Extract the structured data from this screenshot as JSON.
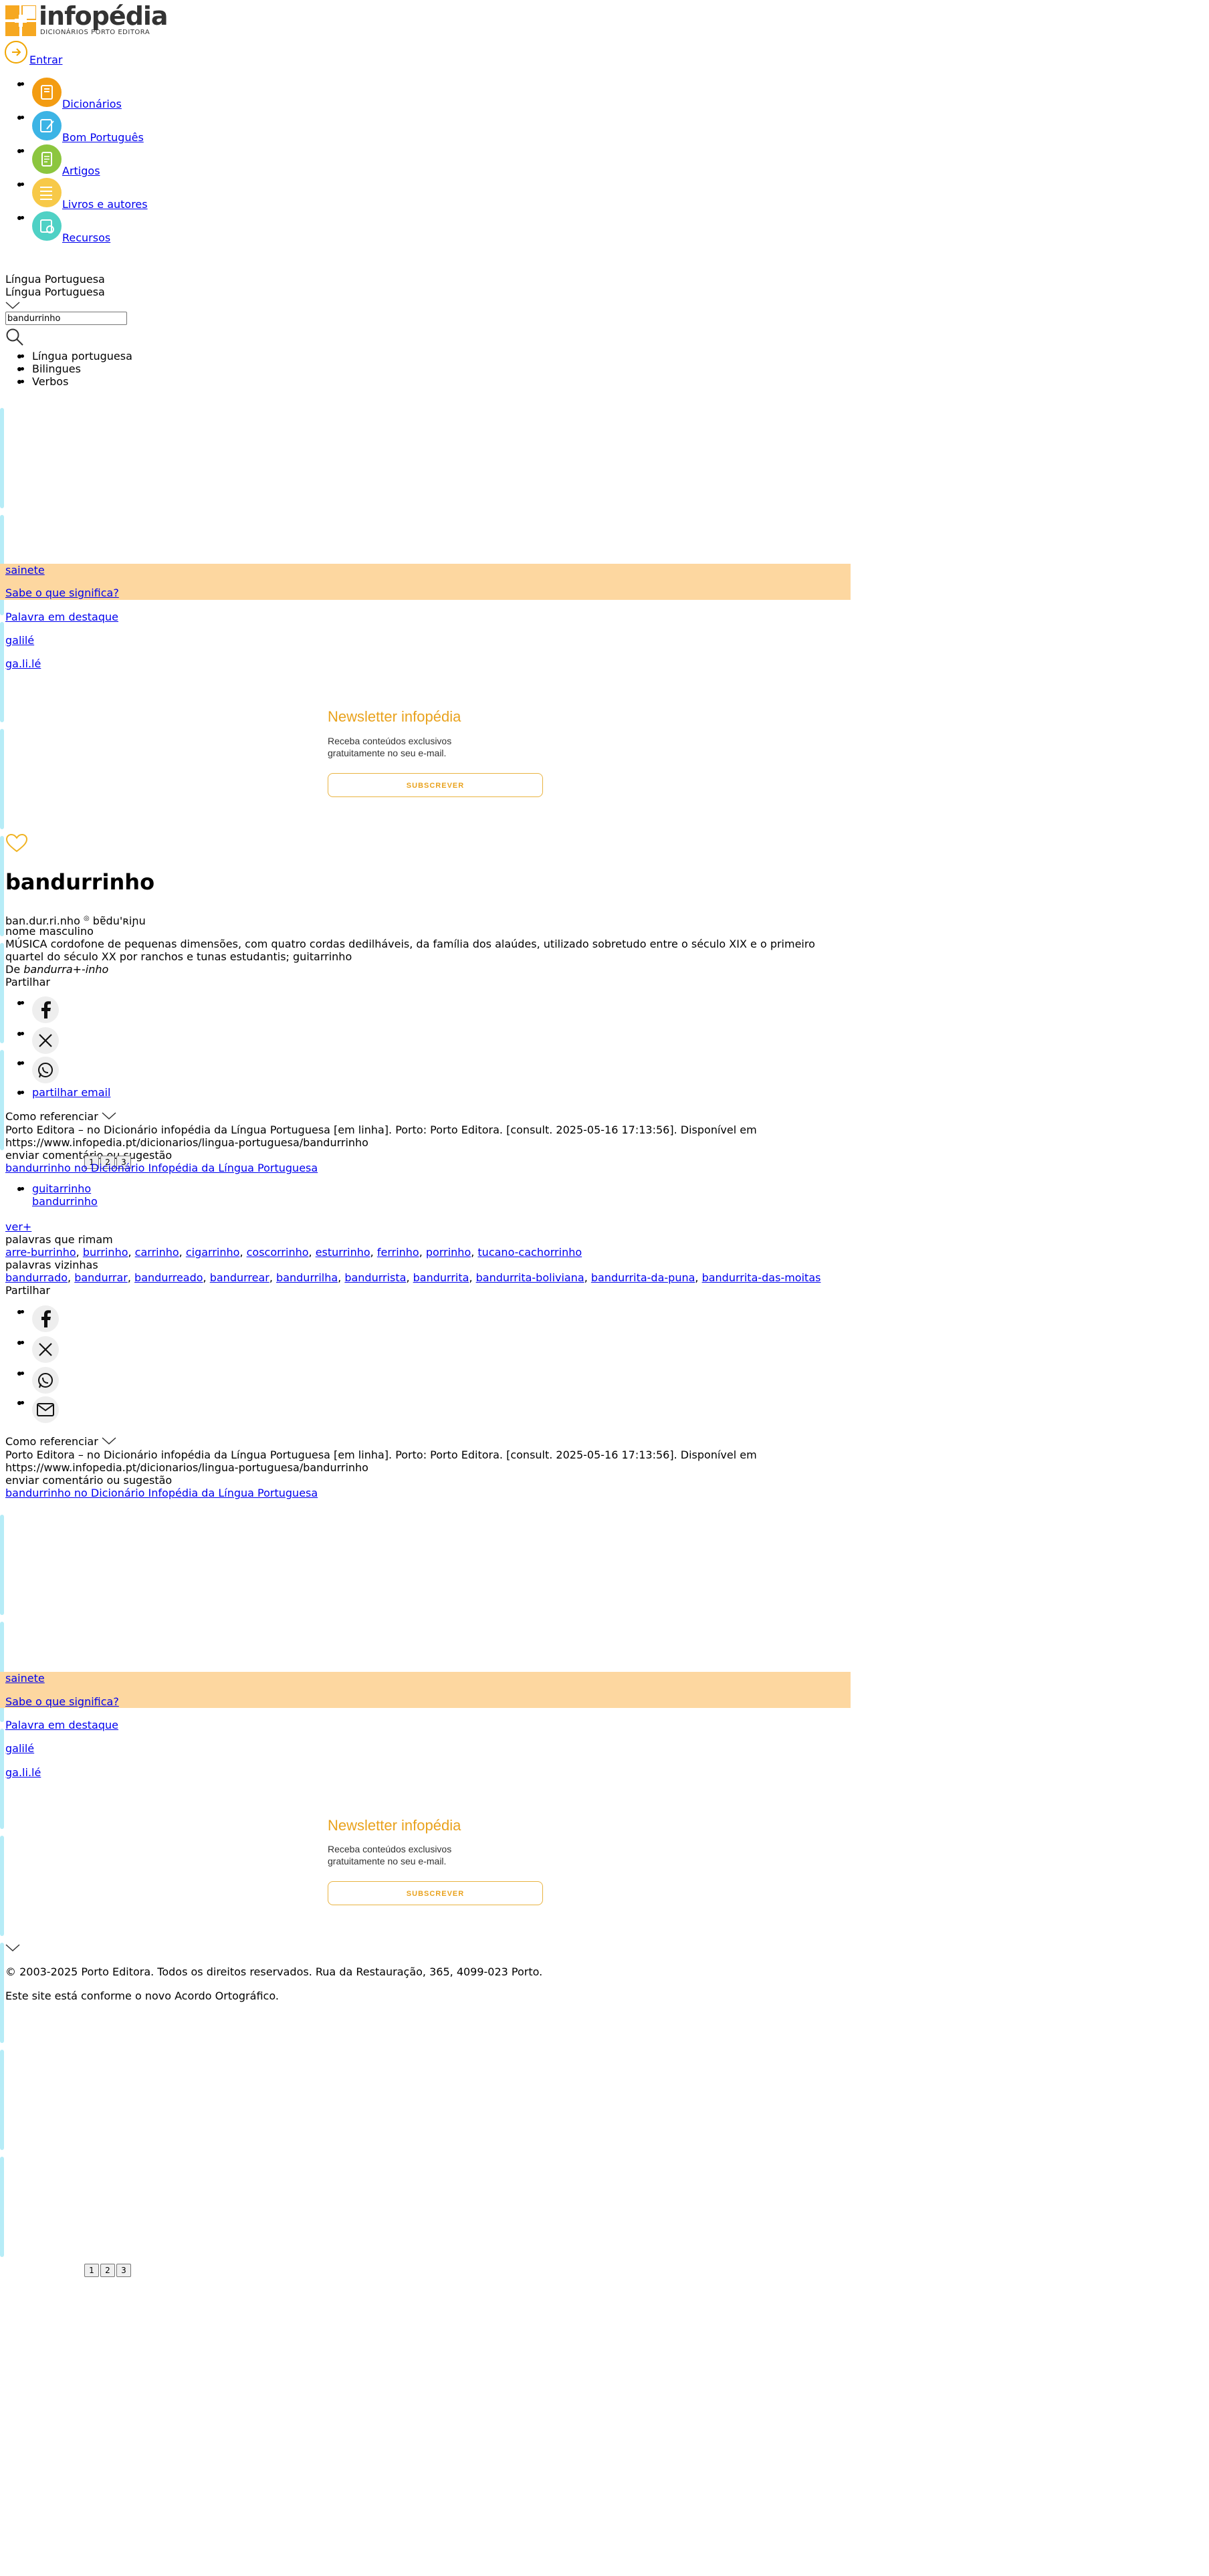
{
  "header": {
    "logo_text": "infopédia",
    "logo_sub": "DICIONÁRIOS PORTO EDITORA",
    "login_label": "Entrar",
    "brand_color": "#f39c12"
  },
  "nav": {
    "items": [
      {
        "label": "Dicionários",
        "icon": "book-icon",
        "color": "#f39c12"
      },
      {
        "label": "Bom Português",
        "icon": "pencil-icon",
        "color": "#3cb4e5"
      },
      {
        "label": "Artigos",
        "icon": "document-icon",
        "color": "#8cc63f"
      },
      {
        "label": "Livros e autores",
        "icon": "books-icon",
        "color": "#f7c948"
      },
      {
        "label": "Recursos",
        "icon": "resources-icon",
        "color": "#4fd1c5"
      }
    ]
  },
  "search": {
    "dictionary_label": "Língua Portuguesa",
    "dictionary_selected": "Língua Portuguesa",
    "query": "bandurrinho",
    "categories": [
      "Língua portuguesa",
      "Bilingues",
      "Verbos"
    ]
  },
  "promo": {
    "featured_word": "sainete",
    "know_meaning": "Sabe o que significa?",
    "highlight_label": "Palavra em destaque",
    "highlight_word": "galilé",
    "highlight_syllables": "ga.li.lé"
  },
  "newsletter": {
    "title": "Newsletter infopédia",
    "text_line1": "Receba conteúdos exclusivos",
    "text_line2": "gratuitamente no seu e-mail.",
    "button": "SUBSCREVER"
  },
  "entry": {
    "word": "bandurrinho",
    "syllables": "ban.dur.ri.nho",
    "pron_marker": "◎",
    "pronunciation": "bɐ̃du'ʀiɲu",
    "grammar": "nome masculino",
    "definition_line1": "MÚSICA cordofone de pequenas dimensões, com quatro cordas dedilháveis, da família dos alaúdes, utilizado sobretudo entre o século XIX e o primeiro",
    "definition_line2": "quartel do século XX por ranchos e tunas estudantis; guitarrinho",
    "etym_prefix": "De",
    "etym_word": "bandurra+-inho",
    "share_label": "Partilhar",
    "share_email_alt": "partilhar email",
    "cite_label": "Como referenciar",
    "cite_line1": "Porto Editora – no Dicionário infopédia da Língua Portuguesa [em linha]. Porto: Porto Editora. [consult. 2025-05-16 17:13:56]. Disponível em",
    "cite_line2": "https://www.infopedia.pt/dicionarios/lingua-portuguesa/bandurrinho",
    "comment_label": "enviar comentário ou sugestão",
    "image_alt": "bandurrinho no Dicionário Infopédia da Língua Portuguesa"
  },
  "synonyms": {
    "items": [
      "guitarrinho",
      "bandurrinho"
    ],
    "see_more": "ver+"
  },
  "rhymes": {
    "label": "palavras que rimam",
    "items": [
      "arre-burrinho",
      "burrinho",
      "carrinho",
      "cigarrinho",
      "coscorrinho",
      "esturrinho",
      "ferrinho",
      "porrinho",
      "tucano-cachorrinho"
    ]
  },
  "neighbors": {
    "label": "palavras vizinhas",
    "items": [
      "bandurrado",
      "bandurrar",
      "bandurreado",
      "bandurrear",
      "bandurrilha",
      "bandurrista",
      "bandurrita",
      "bandurrita-boliviana",
      "bandurrita-da-puna",
      "bandurrita-das-moitas"
    ]
  },
  "pager": {
    "pages": [
      "1",
      "2",
      "3"
    ]
  },
  "footer": {
    "copyright": "© 2003-2025 Porto Editora. Todos os direitos reservados. Rua da Restauração, 365, 4099-023 Porto.",
    "agreement": "Este site está conforme o novo Acordo Ortográfico."
  }
}
